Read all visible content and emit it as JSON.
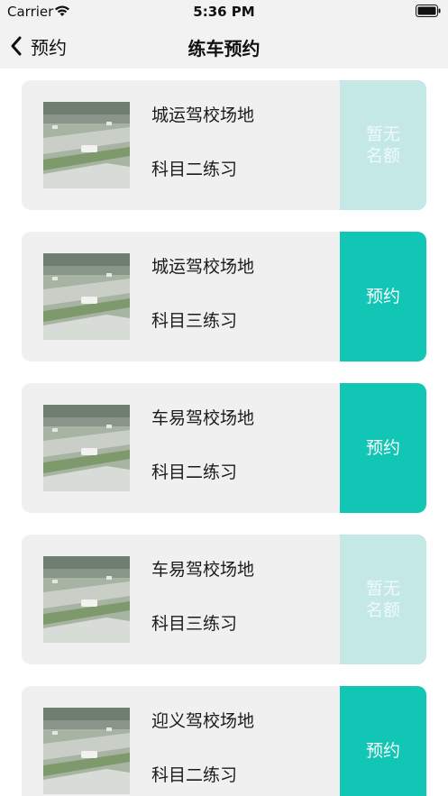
{
  "status_bar": {
    "carrier": "Carrier",
    "time": "5:36 PM",
    "icons": [
      "wifi-icon",
      "battery-icon"
    ]
  },
  "nav": {
    "back_label": "预约",
    "title": "练车预约",
    "back_icon": "chevron-left-icon"
  },
  "colors": {
    "available": "#12c6b6",
    "full": "#c4e8e5",
    "card_bg": "#f0f0f0",
    "nav_bg": "#f2f2f2"
  },
  "items": [
    {
      "venue": "城运驾校场地",
      "subject": "科目二练习",
      "status": "full",
      "action_line1": "暂无",
      "action_line2": "名额"
    },
    {
      "venue": "城运驾校场地",
      "subject": "科目三练习",
      "status": "available",
      "action_line1": "预约",
      "action_line2": ""
    },
    {
      "venue": "车易驾校场地",
      "subject": "科目二练习",
      "status": "available",
      "action_line1": "预约",
      "action_line2": ""
    },
    {
      "venue": "车易驾校场地",
      "subject": "科目三练习",
      "status": "full",
      "action_line1": "暂无",
      "action_line2": "名额"
    },
    {
      "venue": "迎义驾校场地",
      "subject": "科目二练习",
      "status": "available",
      "action_line1": "预约",
      "action_line2": ""
    }
  ]
}
